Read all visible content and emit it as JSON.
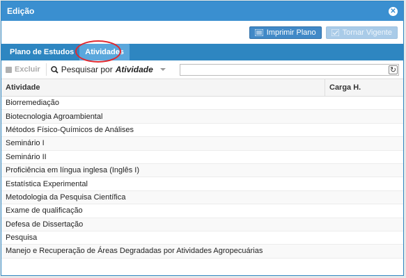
{
  "window": {
    "title": "Edição"
  },
  "toolbar": {
    "print_label": "Imprimir Plano",
    "make_current_label": "Tornar Vigente"
  },
  "tabs": [
    {
      "label": "Plano de Estudos",
      "active": false
    },
    {
      "label": "Atividades",
      "active": true
    }
  ],
  "actions": {
    "delete_label": "Excluir",
    "search_prefix": "Pesquisar por",
    "search_field": "Atividade",
    "search_value": ""
  },
  "table": {
    "columns": [
      "Atividade",
      "Carga H."
    ],
    "rows": [
      {
        "atividade": "Biorremediação",
        "carga": ""
      },
      {
        "atividade": "Biotecnologia Agroambiental",
        "carga": ""
      },
      {
        "atividade": "Métodos Físico-Químicos de Análises",
        "carga": ""
      },
      {
        "atividade": "Seminário I",
        "carga": ""
      },
      {
        "atividade": "Seminário II",
        "carga": ""
      },
      {
        "atividade": "Proficiência em língua inglesa (Inglês I)",
        "carga": ""
      },
      {
        "atividade": "Estatística Experimental",
        "carga": ""
      },
      {
        "atividade": "Metodologia da Pesquisa Científica",
        "carga": ""
      },
      {
        "atividade": "Exame de qualificação",
        "carga": ""
      },
      {
        "atividade": "Defesa de Dissertação",
        "carga": ""
      },
      {
        "atividade": "Pesquisa",
        "carga": ""
      },
      {
        "atividade": "Manejo e Recuperação de Áreas Degradadas por Atividades Agropecuárias",
        "carga": ""
      }
    ]
  },
  "colors": {
    "primary": "#2e86c1",
    "title_bar": "#3a8fd0",
    "highlight_ring": "#e0292f"
  },
  "icons": [
    "close-icon",
    "print-icon",
    "check-icon",
    "trash-icon",
    "search-icon",
    "refresh-icon"
  ]
}
